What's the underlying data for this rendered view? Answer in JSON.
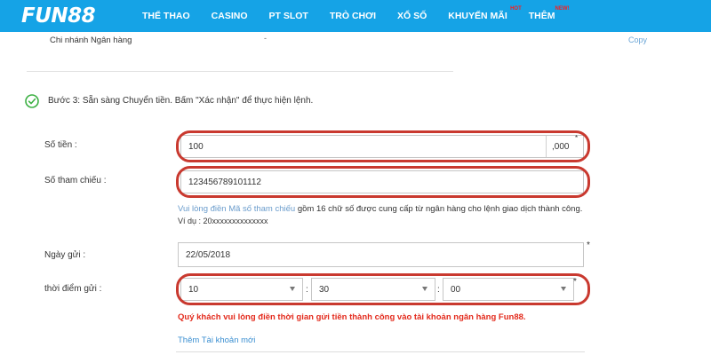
{
  "brand": {
    "logo_text": "FUN88",
    "nav_color": "#15a3e6",
    "ring_color": "#c9392f"
  },
  "nav": {
    "items": [
      {
        "label": "THỂ THAO",
        "badge": ""
      },
      {
        "label": "CASINO",
        "badge": ""
      },
      {
        "label": "PT SLOT",
        "badge": ""
      },
      {
        "label": "TRÒ CHƠI",
        "badge": ""
      },
      {
        "label": "XỔ SỐ",
        "badge": ""
      },
      {
        "label": "KHUYẾN MÃI",
        "badge": "HOT"
      },
      {
        "label": "THÊM",
        "badge": "NEW!"
      }
    ]
  },
  "bank_branch": {
    "label": "Chi nhánh Ngân hàng",
    "value": "-",
    "copy_label": "Copy"
  },
  "step": {
    "icon": "check-circle-icon",
    "text": "Bước 3: Sẵn sàng Chuyển tiền. Bấm \"Xác nhận\" để thực hiện lệnh."
  },
  "form": {
    "amount": {
      "label": "Số tiền :",
      "value": "100",
      "suffix": ",000",
      "required_mark": "*"
    },
    "reference": {
      "label": "Số tham chiếu :",
      "value": "123456789101112",
      "helper_link": "Vui lòng điền Mã số tham chiếu",
      "helper_rest": " gồm 16 chữ số được cung cấp từ ngân hàng cho lệnh giao dịch thành công.",
      "example": "Ví dụ : 20xxxxxxxxxxxxxx"
    },
    "date": {
      "label": "Ngày gửi :",
      "value": "22/05/2018",
      "required_mark": "*"
    },
    "time": {
      "label": "thời điểm gửi :",
      "hour": "10",
      "minute": "30",
      "second": "00",
      "separator": ":",
      "required_mark": "*"
    },
    "warning": "Quý khách vui lòng điền thời gian gửi tiền thành công vào tài khoản ngân hàng Fun88.",
    "add_account": "Thêm Tài khoản mới"
  }
}
